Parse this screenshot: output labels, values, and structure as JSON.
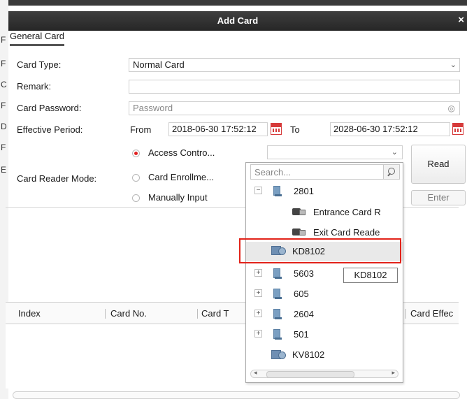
{
  "background_letters": [
    "F",
    "F",
    "C",
    "F",
    "D",
    "F",
    "E"
  ],
  "dialog": {
    "title": "Add Card",
    "close_glyph": "×",
    "tab_label": "General Card"
  },
  "form": {
    "card_type_label": "Card Type:",
    "card_type_value": "Normal Card",
    "remark_label": "Remark:",
    "remark_value": "",
    "password_label": "Card Password:",
    "password_placeholder": "Password",
    "effective_label": "Effective Period:",
    "from_label": "From",
    "from_value": "2018-06-30 17:52:12",
    "to_label": "To",
    "to_value": "2028-06-30 17:52:12",
    "reader_mode_label": "Card Reader Mode:",
    "reader_options": [
      "Access Contro...",
      "Card Enrollme...",
      "Manually Input"
    ],
    "reader_selected_index": 0,
    "read_button": "Read",
    "enter_button": "Enter"
  },
  "table": {
    "columns": [
      "Index",
      "Card No.",
      "Card T",
      "Card Effec"
    ]
  },
  "dropdown": {
    "search_placeholder": "Search...",
    "tree": [
      {
        "label": "2801",
        "icon": "device-icon",
        "expander": "−",
        "depth": 0
      },
      {
        "label": "Entrance Card R",
        "icon": "card-reader-icon",
        "expander": "",
        "depth": 1
      },
      {
        "label": "Exit Card Reade",
        "icon": "card-reader-icon",
        "expander": "",
        "depth": 1
      },
      {
        "label": "KD8102",
        "icon": "access-controller-icon",
        "expander": "",
        "depth": 0,
        "highlighted": true
      },
      {
        "label": "5603",
        "icon": "device-icon",
        "expander": "+",
        "depth": 0
      },
      {
        "label": "605",
        "icon": "device-icon",
        "expander": "+",
        "depth": 0
      },
      {
        "label": "2604",
        "icon": "device-icon",
        "expander": "+",
        "depth": 0
      },
      {
        "label": "501",
        "icon": "device-icon",
        "expander": "+",
        "depth": 0
      },
      {
        "label": "KV8102",
        "icon": "access-controller-icon",
        "expander": "",
        "depth": 0
      }
    ],
    "tooltip": "KD8102"
  },
  "colors": {
    "titlebar": "#2f2f2f",
    "radio_selected": "#e02020",
    "highlight_box": "#e2231a"
  }
}
